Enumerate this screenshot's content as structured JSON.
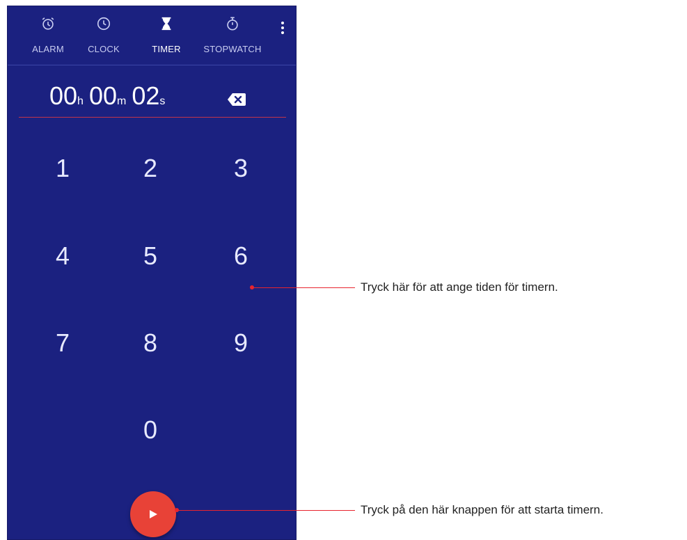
{
  "tabs": [
    {
      "label": "ALARM",
      "icon": "alarm-clock-icon"
    },
    {
      "label": "CLOCK",
      "icon": "clock-icon"
    },
    {
      "label": "TIMER",
      "icon": "hourglass-icon",
      "active": true
    },
    {
      "label": "STOPWATCH",
      "icon": "stopwatch-icon"
    }
  ],
  "timer_display": {
    "hours": "00",
    "hours_unit": "h",
    "minutes": "00",
    "minutes_unit": "m",
    "seconds": "02",
    "seconds_unit": "s"
  },
  "keypad": [
    "1",
    "2",
    "3",
    "4",
    "5",
    "6",
    "7",
    "8",
    "9",
    "0"
  ],
  "callouts": {
    "keypad_hint": "Tryck här för att ange tiden för timern.",
    "start_hint": "Tryck på den här knappen för att starta timern."
  },
  "colors": {
    "background": "#1b2180",
    "accent": "#e84237",
    "callout": "#e8242e",
    "underline": "#c2344a"
  }
}
